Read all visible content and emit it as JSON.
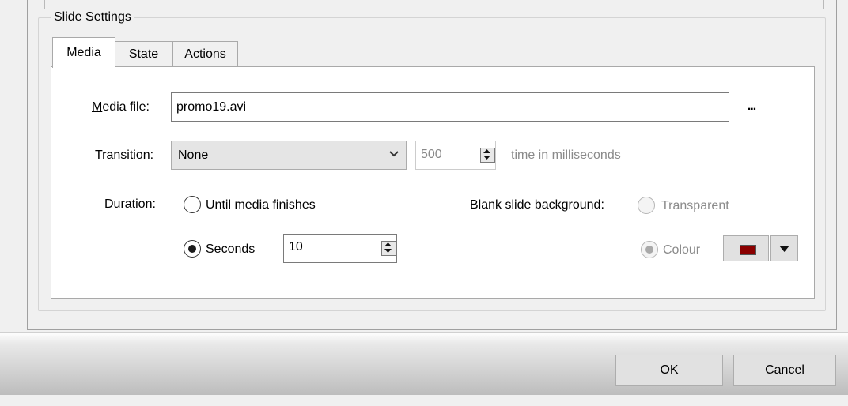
{
  "group": {
    "title": "Slide Settings"
  },
  "tabs": [
    {
      "label": "Media",
      "active": true
    },
    {
      "label": "State",
      "active": false
    },
    {
      "label": "Actions",
      "active": false
    }
  ],
  "media": {
    "file_label_mnemonic": "M",
    "file_label_rest": "edia file:",
    "file_value": "promo19.avi",
    "browse_label": "..."
  },
  "transition": {
    "label": "Transition:",
    "selected": "None",
    "duration_value": "500",
    "duration_hint": "time in milliseconds"
  },
  "duration": {
    "label": "Duration:",
    "option_until_media": {
      "label": "Until media finishes",
      "selected": false
    },
    "option_seconds": {
      "label": "Seconds",
      "selected": true
    },
    "seconds_value": "10"
  },
  "background": {
    "label": "Blank slide background:",
    "option_transparent": {
      "label": "Transparent",
      "selected": false,
      "enabled": false
    },
    "option_colour": {
      "label": "Colour",
      "selected": true,
      "enabled": false
    },
    "colour_value": "#8b0000"
  },
  "footer": {
    "ok_label": "OK",
    "cancel_label": "Cancel"
  },
  "icons": {
    "transition_dropdown": "chevron-down-icon",
    "spin_up": "spin-up-icon",
    "spin_down": "spin-down-icon",
    "colour_dropdown": "caret-down-icon"
  }
}
